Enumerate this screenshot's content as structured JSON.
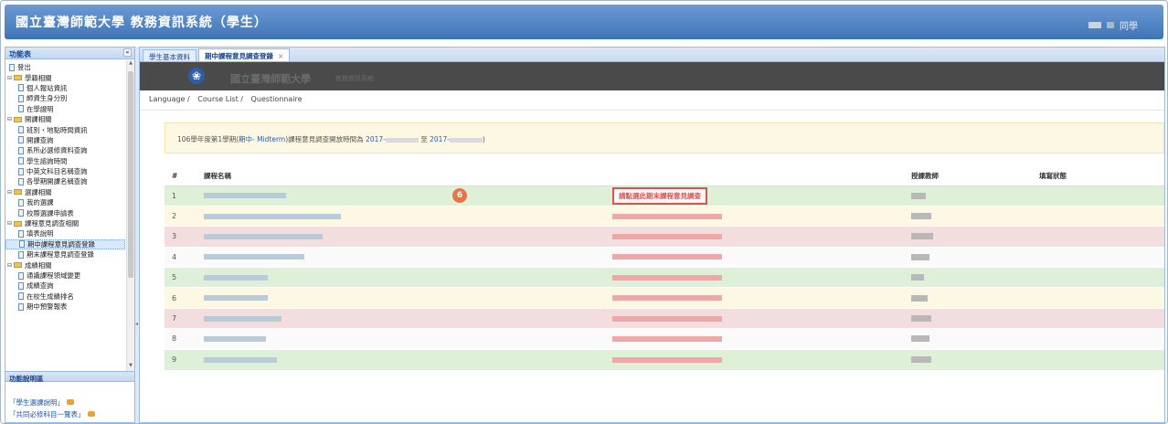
{
  "header": {
    "title": "國立臺灣師範大學 教務資訊系統（學生）",
    "user_suffix": "同學"
  },
  "sidebar": {
    "title": "功能表",
    "collapse": "«",
    "items": [
      {
        "label": "登出",
        "type": "doc",
        "level": 0
      },
      {
        "label": "學籍相關",
        "type": "folder",
        "level": 0
      },
      {
        "label": "個人報站資訊",
        "type": "doc",
        "level": 1
      },
      {
        "label": "師資生身分別",
        "type": "doc",
        "level": 1
      },
      {
        "label": "在學證明",
        "type": "doc",
        "level": 1
      },
      {
        "label": "開課相關",
        "type": "folder",
        "level": 0
      },
      {
        "label": "班別・地點時間資訊",
        "type": "doc",
        "level": 1
      },
      {
        "label": "開課查詢",
        "type": "doc",
        "level": 1
      },
      {
        "label": "系所必選修資料查詢",
        "type": "doc",
        "level": 1
      },
      {
        "label": "學生諮詢時間",
        "type": "doc",
        "level": 1
      },
      {
        "label": "中英文科目名稱查詢",
        "type": "doc",
        "level": 1
      },
      {
        "label": "各學期開課名稱查詢",
        "type": "doc",
        "level": 1
      },
      {
        "label": "選課相關",
        "type": "folder",
        "level": 0
      },
      {
        "label": "我的選課",
        "type": "doc",
        "level": 1
      },
      {
        "label": "校際選課申請表",
        "type": "doc",
        "level": 1
      },
      {
        "label": "課程意見調查相關",
        "type": "folder",
        "level": 0
      },
      {
        "label": "填表說明",
        "type": "doc",
        "level": 1
      },
      {
        "label": "期中課程意見調查登錄",
        "type": "doc",
        "level": 1,
        "selected": true
      },
      {
        "label": "期末課程意見調查登錄",
        "type": "doc",
        "level": 1
      },
      {
        "label": "成績相關",
        "type": "folder",
        "level": 0
      },
      {
        "label": "通識課程領域變更",
        "type": "doc",
        "level": 1
      },
      {
        "label": "成績查詢",
        "type": "doc",
        "level": 1
      },
      {
        "label": "在校生成績排名",
        "type": "doc",
        "level": 1
      },
      {
        "label": "期中預警報表",
        "type": "doc",
        "level": 1
      }
    ],
    "help_title": "功能說明區",
    "help_links": [
      "「學生選課說明」",
      "「共同必修科目一覽表」"
    ]
  },
  "tabs": [
    {
      "label": "學生基本資料",
      "active": false
    },
    {
      "label": "期中課程意見調查登錄",
      "active": true,
      "close": "×"
    }
  ],
  "banner": {
    "logo_glyph": "❀",
    "school": "國立臺灣師範大學",
    "sub": "教務資訊系統"
  },
  "breadcrumb": [
    "Language /",
    "Course List /",
    "Questionnaire"
  ],
  "notice": {
    "prefix": "106學年度第1學期(",
    "highlight": "期中- Midterm",
    "middle": ")課程意見調查開放時間為 ",
    "start": "2017-",
    "to": " 至 ",
    "end": "2017-",
    "suffix": ")"
  },
  "table": {
    "headers": [
      "#",
      "課程名稱",
      "",
      "授課教師",
      "填寫狀態"
    ],
    "rows": [
      {
        "index": "1",
        "style": "green",
        "name_w": 90,
        "teacher_w": 16,
        "action": "請點選此期末課程意見調查",
        "highlighted": true
      },
      {
        "index": "2",
        "style": "yellow",
        "name_w": 150,
        "teacher_w": 22
      },
      {
        "index": "3",
        "style": "red",
        "name_w": 130,
        "teacher_w": 24
      },
      {
        "index": "4",
        "style": "white",
        "name_w": 110,
        "teacher_w": 20
      },
      {
        "index": "5",
        "style": "green",
        "name_w": 70,
        "teacher_w": 14
      },
      {
        "index": "6",
        "style": "yellow",
        "name_w": 70,
        "teacher_w": 18
      },
      {
        "index": "7",
        "style": "red",
        "name_w": 85,
        "teacher_w": 22
      },
      {
        "index": "8",
        "style": "white",
        "name_w": 68,
        "teacher_w": 20
      },
      {
        "index": "9",
        "style": "green",
        "name_w": 80,
        "teacher_w": 22
      }
    ]
  },
  "step_badge": "6"
}
